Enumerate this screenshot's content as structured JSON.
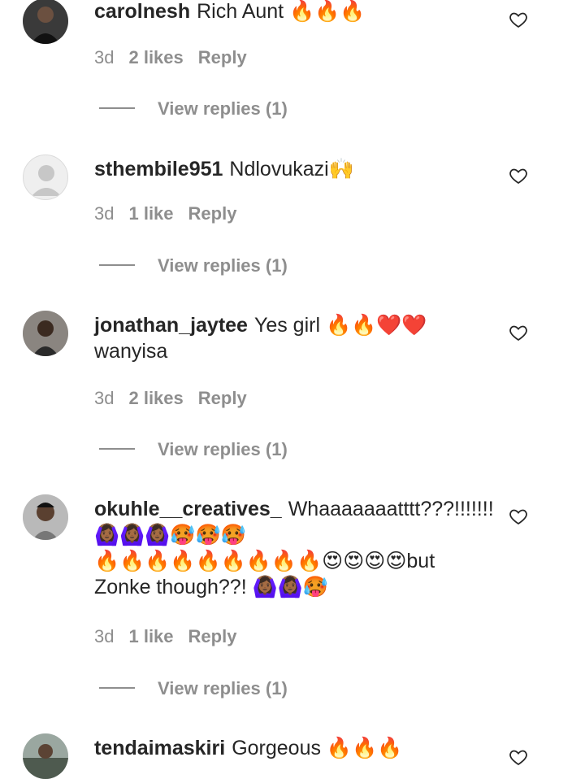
{
  "comments": [
    {
      "username": "carolnesh",
      "text": "Rich Aunt 🔥🔥🔥",
      "time": "3d",
      "likes": "2 likes",
      "reply": "Reply",
      "view_replies": "View replies (1)"
    },
    {
      "username": "sthembile951",
      "text": "Ndlovukazi🙌",
      "time": "3d",
      "likes": "1 like",
      "reply": "Reply",
      "view_replies": "View replies (1)"
    },
    {
      "username": "jonathan_jaytee",
      "text": "Yes girl 🔥🔥❤️❤️\nwanyisa",
      "time": "3d",
      "likes": "2 likes",
      "reply": "Reply",
      "view_replies": "View replies (1)"
    },
    {
      "username": "okuhle__creatives_",
      "text": "Whaaaaaaatttt???!!!!!!!🙆🏾‍♀️🙆🏾‍♀️🙆🏾‍♀️🥵🥵🥵\n🔥🔥🔥🔥🔥🔥🔥🔥🔥😍😍😍😍but\nZonke though??! 🙆🏾‍♀️🙆🏾‍♀️🥵",
      "time": "3d",
      "likes": "1 like",
      "reply": "Reply",
      "view_replies": "View replies (1)"
    },
    {
      "username": "tendaimaskiri",
      "text": "Gorgeous 🔥🔥🔥"
    }
  ],
  "icons": {
    "like": "heart-outline-icon",
    "default_avatar": "default-avatar-icon"
  },
  "colors": {
    "text": "#262626",
    "secondary": "#8e8e8e"
  }
}
